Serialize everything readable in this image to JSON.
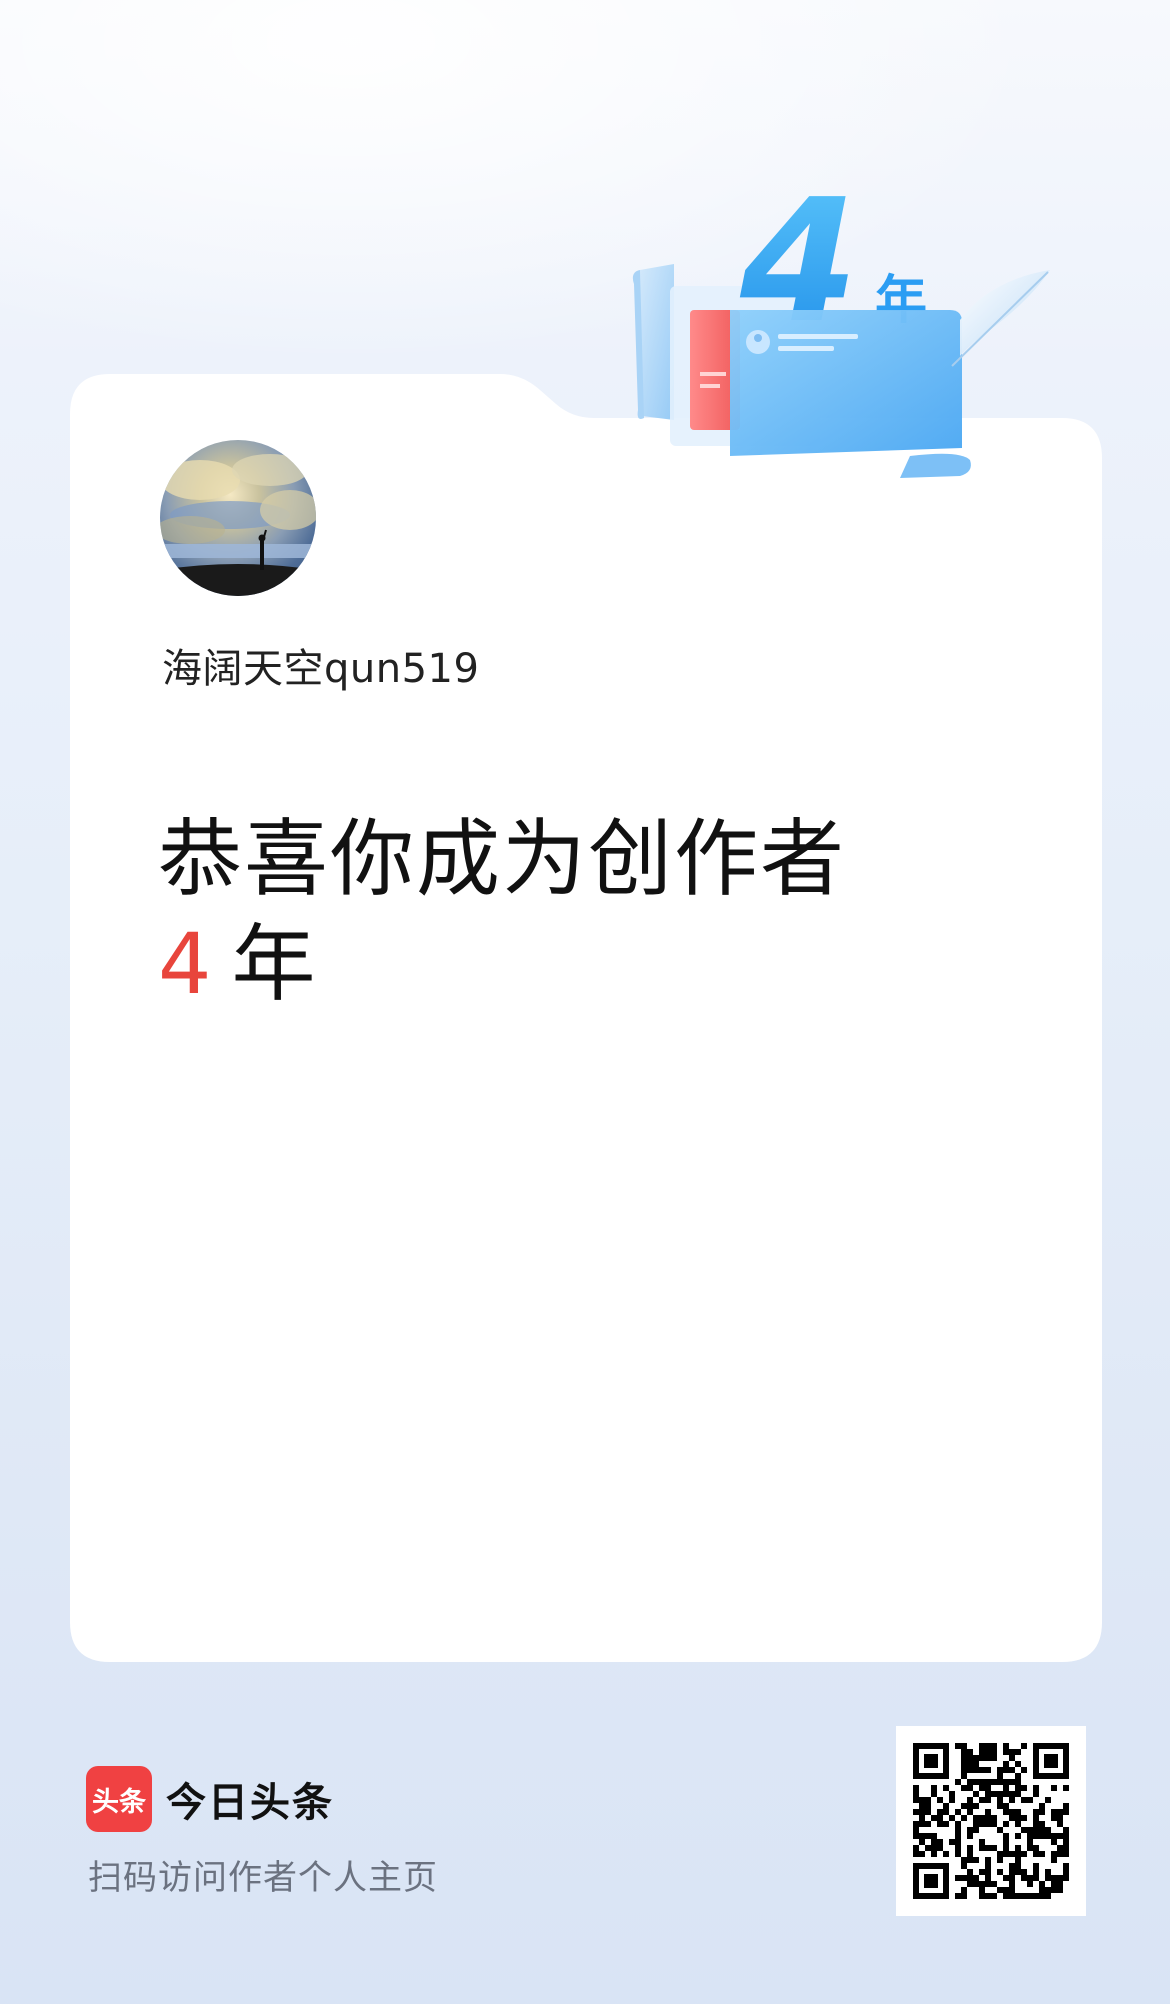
{
  "author": {
    "name": "海阔天空qun519"
  },
  "headline": {
    "line1": "恭喜你成为创作者",
    "years_number": "4",
    "years_unit": "年"
  },
  "badge": {
    "number": "4",
    "unit": "年"
  },
  "footer": {
    "logo_mark": "头条",
    "app_name": "今日头条",
    "caption": "扫码访问作者个人主页"
  },
  "colors": {
    "accent_red": "#e8453c",
    "logo_red": "#f04142",
    "badge_blue": "#2b9df3",
    "caption_gray": "#6b7280"
  },
  "icons": {
    "avatar": "landscape-sky-photo",
    "badge": "anniversary-4-year-badge",
    "qr": "qr-code"
  }
}
